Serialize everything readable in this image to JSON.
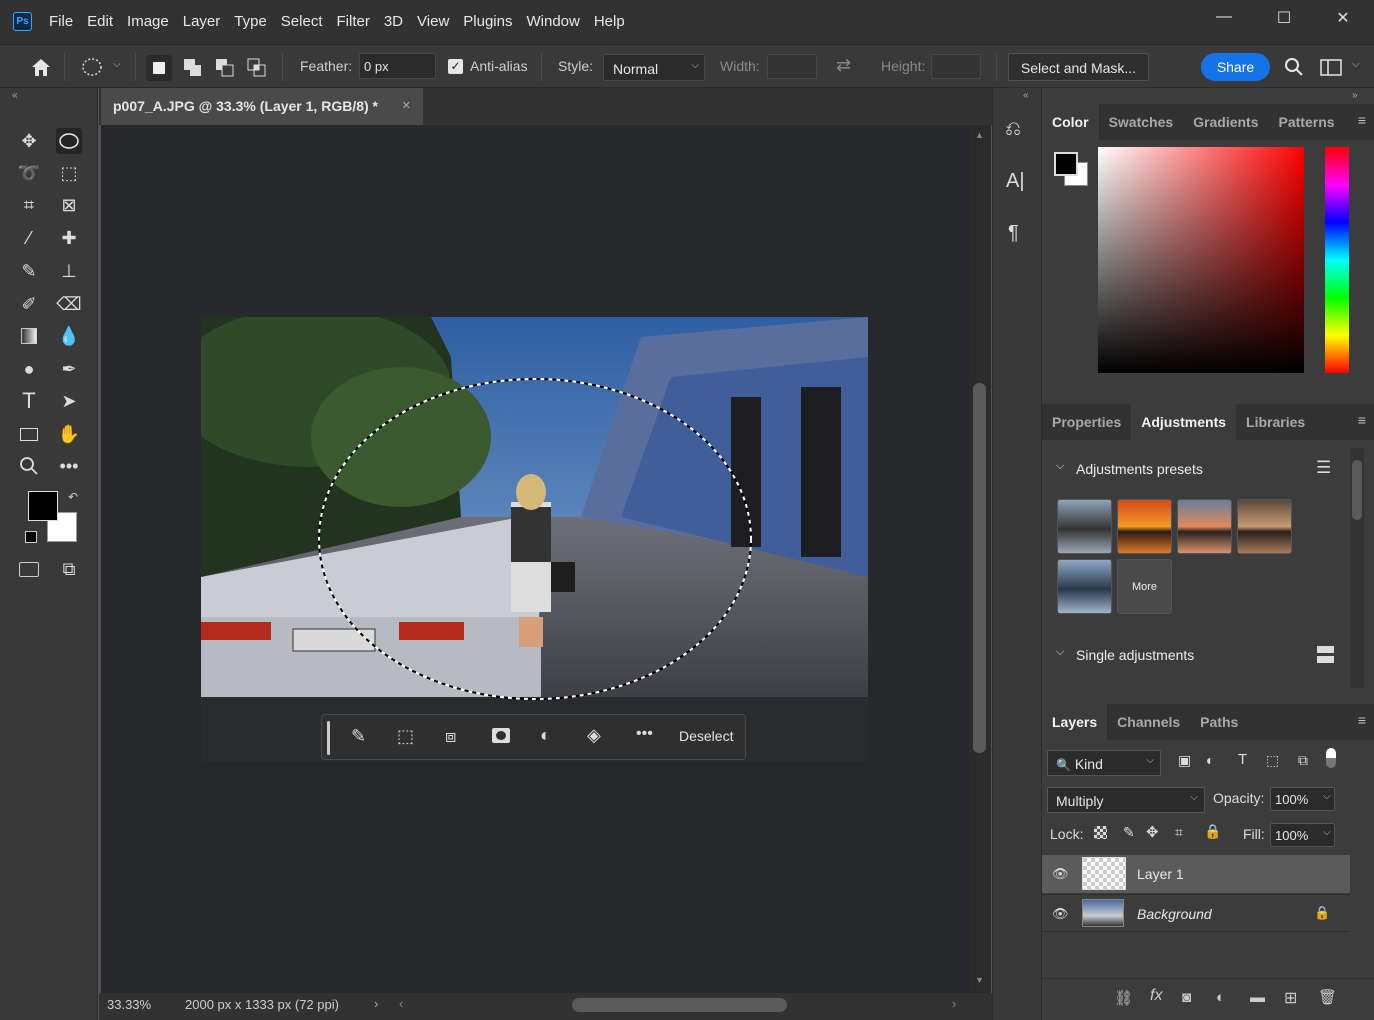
{
  "app": {
    "logo": "Ps",
    "menus": [
      "File",
      "Edit",
      "Image",
      "Layer",
      "Type",
      "Select",
      "Filter",
      "3D",
      "View",
      "Plugins",
      "Window",
      "Help"
    ]
  },
  "window_controls": {
    "minimize": "—",
    "maximize": "☐",
    "close": "✕"
  },
  "options": {
    "feather_label": "Feather:",
    "feather_value": "0 px",
    "antialias_label": "Anti-alias",
    "antialias_checked": true,
    "style_label": "Style:",
    "style_value": "Normal",
    "width_label": "Width:",
    "height_label": "Height:",
    "select_mask_label": "Select and Mask...",
    "share_label": "Share"
  },
  "document": {
    "tab_title": "p007_A.JPG @ 33.3% (Layer 1, RGB/8) *",
    "zoom": "33.33%",
    "info": "2000 px x 1333 px (72 ppi)"
  },
  "contextual_bar": {
    "deselect_label": "Deselect"
  },
  "color_panel": {
    "tabs": [
      "Color",
      "Swatches",
      "Gradients",
      "Patterns"
    ],
    "active": "Color",
    "foreground": "#000000",
    "background": "#ffffff"
  },
  "adjust_panel": {
    "tabs": [
      "Properties",
      "Adjustments",
      "Libraries"
    ],
    "active": "Adjustments",
    "presets_label": "Adjustments presets",
    "more_label": "More",
    "single_label": "Single adjustments"
  },
  "layers_panel": {
    "tabs": [
      "Layers",
      "Channels",
      "Paths"
    ],
    "active": "Layers",
    "kind_label": "Kind",
    "blend_mode": "Multiply",
    "opacity_label": "Opacity:",
    "opacity_value": "100%",
    "lock_label": "Lock:",
    "fill_label": "Fill:",
    "fill_value": "100%",
    "layers": [
      {
        "name": "Layer 1",
        "selected": true
      },
      {
        "name": "Background",
        "selected": false,
        "locked": true
      }
    ]
  },
  "colors": {
    "accent": "#1473e6",
    "bg_dark": "#323232",
    "panel": "#3c3c3c"
  }
}
